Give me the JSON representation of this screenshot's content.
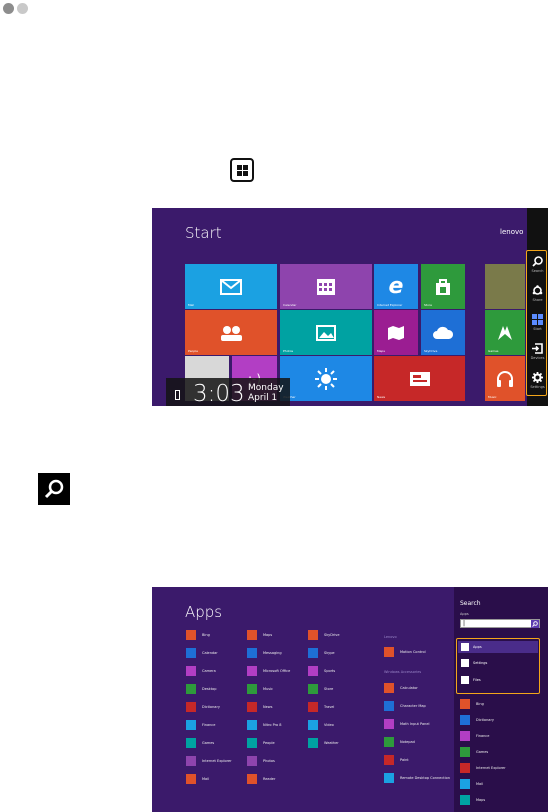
{
  "page_dots": true,
  "start_screen": {
    "title": "Start",
    "user": "lenovo",
    "time": "3:03",
    "day": "Monday",
    "date": "April 1",
    "tiles": [
      {
        "label": "Mail",
        "color": "#1ba1e2",
        "icon": "mail-icon"
      },
      {
        "label": "Calendar",
        "color": "#8e44ad",
        "icon": "calendar-icon"
      },
      {
        "label": "Internet Explorer",
        "color": "#1e88e5",
        "icon": "ie-icon"
      },
      {
        "label": "Store",
        "color": "#2e9a3c",
        "icon": "store-icon"
      },
      {
        "label": "People",
        "color": "#e0522a",
        "icon": "people-icon"
      },
      {
        "label": "Photos",
        "color": "#00a2a2",
        "icon": "photos-icon"
      },
      {
        "label": "Maps",
        "color": "#9b1d92",
        "icon": "maps-icon"
      },
      {
        "label": "SkyDrive",
        "color": "#1e6fd6",
        "icon": "cloud-icon"
      },
      {
        "label": "Weather",
        "color": "#1e88e5",
        "icon": "sun-icon"
      },
      {
        "label": "News",
        "color": "#c62828",
        "icon": "news-icon"
      },
      {
        "label": "Games",
        "color": "#2e9a3c",
        "icon": "games-icon"
      },
      {
        "label": "Music",
        "color": "#e0522a",
        "icon": "headphones-icon"
      },
      {
        "label": "Travel",
        "color": "#8e44ad",
        "icon": "travel-icon"
      }
    ],
    "charms": [
      {
        "label": "Search",
        "icon": "search-icon"
      },
      {
        "label": "Share",
        "icon": "share-icon"
      },
      {
        "label": "Start",
        "icon": "windows-icon"
      },
      {
        "label": "Devices",
        "icon": "devices-icon"
      },
      {
        "label": "Settings",
        "icon": "gear-icon"
      }
    ],
    "accent": "#f3a61a"
  },
  "apps_screen": {
    "title": "Apps",
    "col1": [
      "Bing",
      "Calendar",
      "Camera",
      "Desktop",
      "Dictionary",
      "Finance",
      "Games",
      "Internet Explorer",
      "Mail"
    ],
    "col2": [
      "Maps",
      "Messaging",
      "Microsoft Office",
      "Music",
      "News",
      "Nitro Pro 8",
      "People",
      "Photos",
      "Reader"
    ],
    "col3": [
      "SkyDrive",
      "Skype",
      "Sports",
      "Store",
      "Travel",
      "Video",
      "Weather"
    ],
    "group1": "Lenovo",
    "col4a": [
      "Motion Control"
    ],
    "group2": "Windows Accessories",
    "col4b": [
      "Calculator",
      "Character Map",
      "Math Input Panel",
      "Notepad",
      "Paint",
      "Remote Desktop Connection"
    ],
    "search": {
      "heading": "Search",
      "scope": "Apps",
      "value": "|",
      "options": [
        "Apps",
        "Settings",
        "Files"
      ],
      "results": [
        "Bing",
        "Dictionary",
        "Finance",
        "Games",
        "Internet Explorer",
        "Mail",
        "Maps"
      ]
    }
  }
}
